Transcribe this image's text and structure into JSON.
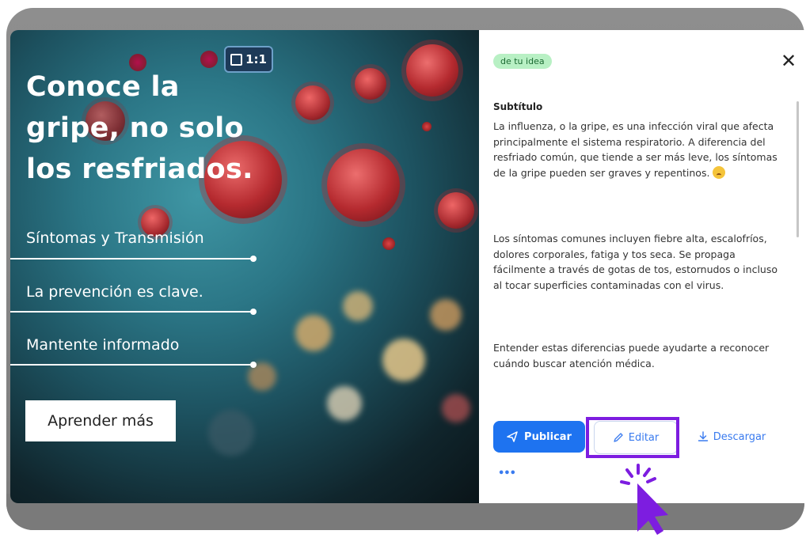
{
  "card": {
    "ratio_label": "1:1",
    "headline_lines": [
      "Conoce la",
      "gripe, no solo",
      "los resfriados."
    ],
    "menu": [
      {
        "label": "Síntomas y Transmisión"
      },
      {
        "label": "La prevención es clave."
      },
      {
        "label": "Mantente informado"
      }
    ],
    "cta_label": "Aprender más"
  },
  "panel": {
    "tag": "de tu idea",
    "close_glyph": "✕",
    "subtitle_label": "Subtítulo",
    "paragraph_1": "La influenza, o la gripe, es una infección viral que afecta principalmente el sistema respiratorio. A diferencia del resfriado común, que tiende a ser más leve, los síntomas de la gripe pueden ser graves y repentinos.",
    "paragraph_2": "Los síntomas comunes incluyen fiebre alta, escalofríos, dolores corporales, fatiga y tos seca. Se propaga fácilmente a través de gotas de tos, estornudos o incluso al tocar superficies contaminadas con el virus.",
    "paragraph_3": "Entender estas diferencias puede ayudarte a reconocer cuándo buscar atención médica.",
    "publish_label": "Publicar",
    "edit_label": "Editar",
    "download_label": "Descargar",
    "more_glyph": "•••"
  },
  "colors": {
    "accent_blue": "#1e73f0",
    "highlight_purple": "#7d1de0",
    "tag_bg": "#b8f0c4"
  },
  "icons": [
    "send-icon",
    "pencil-icon",
    "download-icon",
    "close-icon",
    "more-icon",
    "pointer-cursor-icon"
  ]
}
